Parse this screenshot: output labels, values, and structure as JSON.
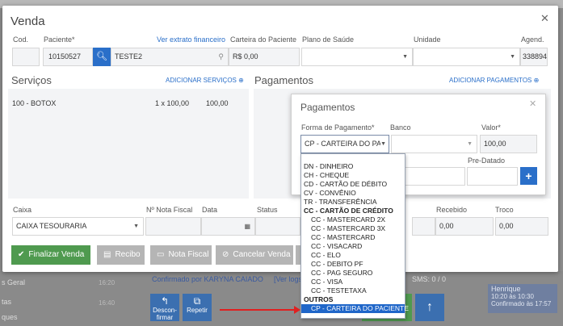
{
  "background": {
    "left_rows": [
      "s Geral",
      "tas",
      "ques"
    ],
    "times": [
      "16:20",
      "16:40"
    ],
    "confirmed_by": "Confirmado por KARYNA CAIADO",
    "ver_logs": "[Ver logs",
    "sms": "SMS: 0 / 0",
    "buttons": {
      "desconfirmar": "Descon-firmar",
      "repetir": "Repetir"
    },
    "card": {
      "name": "Henrique",
      "line1": "10:20 às 10:30",
      "line2": "Confirmado às 17:57"
    }
  },
  "modal": {
    "title": "Venda",
    "fields": {
      "cod_label": "Cod.",
      "cod_value": "",
      "paciente_label": "Paciente*",
      "paciente_id": "10150527",
      "paciente_nome": "TESTE2",
      "ver_extrato": "Ver extrato financeiro",
      "carteira_label": "Carteira do Paciente",
      "carteira_value": "R$ 0,00",
      "plano_label": "Plano de Saúde",
      "plano_value": "",
      "unidade_label": "Unidade",
      "unidade_value": "",
      "agend_label": "Agend.",
      "agend_value": "338894"
    },
    "servicos": {
      "title": "Serviços",
      "add_link": "ADICIONAR SERVIÇOS",
      "items": [
        {
          "nome": "100 - BOTOX",
          "qtd": "1 x 100,00",
          "valor": "100,00"
        }
      ]
    },
    "pagamentos": {
      "title": "Pagamentos",
      "add_link": "ADICIONAR PAGAMENTOS"
    },
    "bottom": {
      "caixa_label": "Caixa",
      "caixa_value": "CAIXA TESOURARIA",
      "nf_label": "Nº Nota Fiscal",
      "data_label": "Data",
      "status_label": "Status",
      "recebido_label": "Recebido",
      "recebido_value": "0,00",
      "troco_label": "Troco",
      "troco_value": "0,00"
    },
    "actions": {
      "finalizar": "Finalizar Venda",
      "recibo": "Recibo",
      "nota_fiscal": "Nota Fiscal",
      "cancelar": "Cancelar Venda"
    },
    "colors": {
      "primary": "#2a6fc9",
      "success": "#4f9a4f",
      "disabled": "#b5b5b5"
    }
  },
  "popup": {
    "title": "Pagamentos",
    "forma_label": "Forma de Pagamento*",
    "forma_value": "CP - CARTEIRA DO PAC",
    "banco_label": "Banco",
    "valor_label": "Valor*",
    "valor_value": "100,00",
    "predatado_label": "Pre-Datado"
  },
  "dropdown": {
    "options": [
      {
        "label": "DN - DINHEIRO",
        "kind": "item"
      },
      {
        "label": "CH - CHEQUE",
        "kind": "item"
      },
      {
        "label": "CD - CARTÃO DE DÉBITO",
        "kind": "item"
      },
      {
        "label": "CV - CONVÊNIO",
        "kind": "item"
      },
      {
        "label": "TR - TRANSFERÊNCIA",
        "kind": "item"
      },
      {
        "label": "CC - CARTÃO DE CRÉDITO",
        "kind": "group"
      },
      {
        "label": "CC - MASTERCARD 2X",
        "kind": "sub"
      },
      {
        "label": "CC - MASTERCARD 3X",
        "kind": "sub"
      },
      {
        "label": "CC - MASTERCARD",
        "kind": "sub"
      },
      {
        "label": "CC - VISACARD",
        "kind": "sub"
      },
      {
        "label": "CC - ELO",
        "kind": "sub"
      },
      {
        "label": "CC - DEBITO PF",
        "kind": "sub"
      },
      {
        "label": "CC - PAG SEGURO",
        "kind": "sub"
      },
      {
        "label": "CC - VISA",
        "kind": "sub"
      },
      {
        "label": "CC - TESTETAXA",
        "kind": "sub"
      },
      {
        "label": "OUTROS",
        "kind": "group"
      },
      {
        "label": "CP - CARTEIRA DO PACIENTE",
        "kind": "sub-selected"
      }
    ]
  }
}
